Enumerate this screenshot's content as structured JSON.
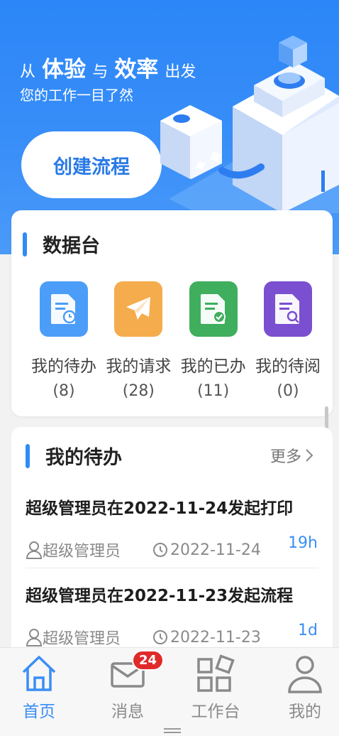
{
  "hero": {
    "title_from": "从",
    "title_exp": "体验",
    "title_and": "与",
    "title_eff": "效率",
    "title_start": "出发",
    "subtitle": "您的工作一目了然",
    "create_button": "创建流程"
  },
  "dashboard": {
    "title": "数据台",
    "items": [
      {
        "label": "我的待办",
        "count": "(8)",
        "color": "#4c9df8",
        "icon": "doc-clock-icon"
      },
      {
        "label": "我的请求",
        "count": "(28)",
        "color": "#f5ac4d",
        "icon": "paper-plane-icon"
      },
      {
        "label": "我的已办",
        "count": "(11)",
        "color": "#3fae5d",
        "icon": "doc-check-icon"
      },
      {
        "label": "我的待阅",
        "count": "(0)",
        "color": "#7a4fd0",
        "icon": "doc-search-icon"
      }
    ]
  },
  "todo": {
    "title": "我的待办",
    "more": "更多",
    "items": [
      {
        "title": "超级管理员在2022-11-24发起打印",
        "user": "超级管理员",
        "date": "2022-11-24",
        "age": "19h"
      },
      {
        "title": "超级管理员在2022-11-23发起流程",
        "user": "超级管理员",
        "date": "2022-11-23",
        "age": "1d"
      }
    ]
  },
  "tabbar": {
    "tabs": [
      {
        "label": "首页",
        "icon": "home-icon",
        "active": true
      },
      {
        "label": "消息",
        "icon": "mail-icon",
        "badge": "24"
      },
      {
        "label": "工作台",
        "icon": "apps-icon"
      },
      {
        "label": "我的",
        "icon": "user-icon"
      }
    ]
  },
  "colors": {
    "primary": "#2f8cf5",
    "badge": "#e02a2a"
  }
}
